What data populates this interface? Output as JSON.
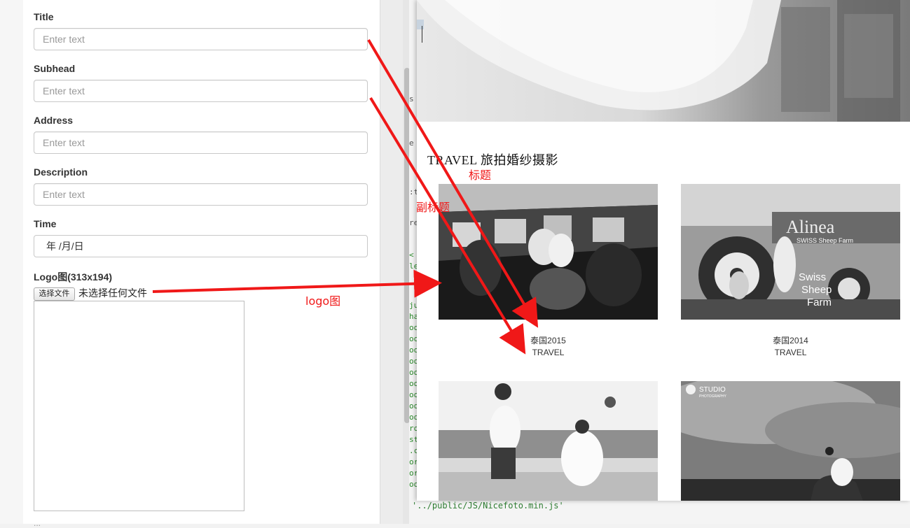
{
  "form": {
    "fields": [
      {
        "label": "Title",
        "placeholder": "Enter text"
      },
      {
        "label": "Subhead",
        "placeholder": "Enter text"
      },
      {
        "label": "Address",
        "placeholder": "Enter text"
      },
      {
        "label": "Description",
        "placeholder": "Enter text"
      }
    ],
    "time": {
      "label": "Time",
      "value": "年 /月/日"
    },
    "logo": {
      "label": "Logo图(313x194)",
      "button_label": "选择文件",
      "file_status": "未选择任何文件"
    },
    "next_label_cut": "..."
  },
  "editor": {
    "code_line": "'../public/JS/Nicefoto.min.js'"
  },
  "preview": {
    "section_title": "TRAVEL 旅拍婚纱摄影",
    "items": [
      {
        "title": "泰国2015",
        "subhead": "TRAVEL"
      },
      {
        "title": "泰国2014",
        "subhead": "TRAVEL"
      }
    ],
    "sign_text": {
      "top": "Alinea",
      "lines": [
        "Swiss",
        "Sheep",
        "Farm"
      ],
      "banner": "SWISS Sheep Farm"
    },
    "studio_watermark": {
      "name": "STUDIO",
      "tag": "PHOTOGRAPHY"
    }
  },
  "annotations": {
    "title_label": "标题",
    "subhead_label": "副标题",
    "logo_label": "logo图",
    "color": "#f01818"
  }
}
